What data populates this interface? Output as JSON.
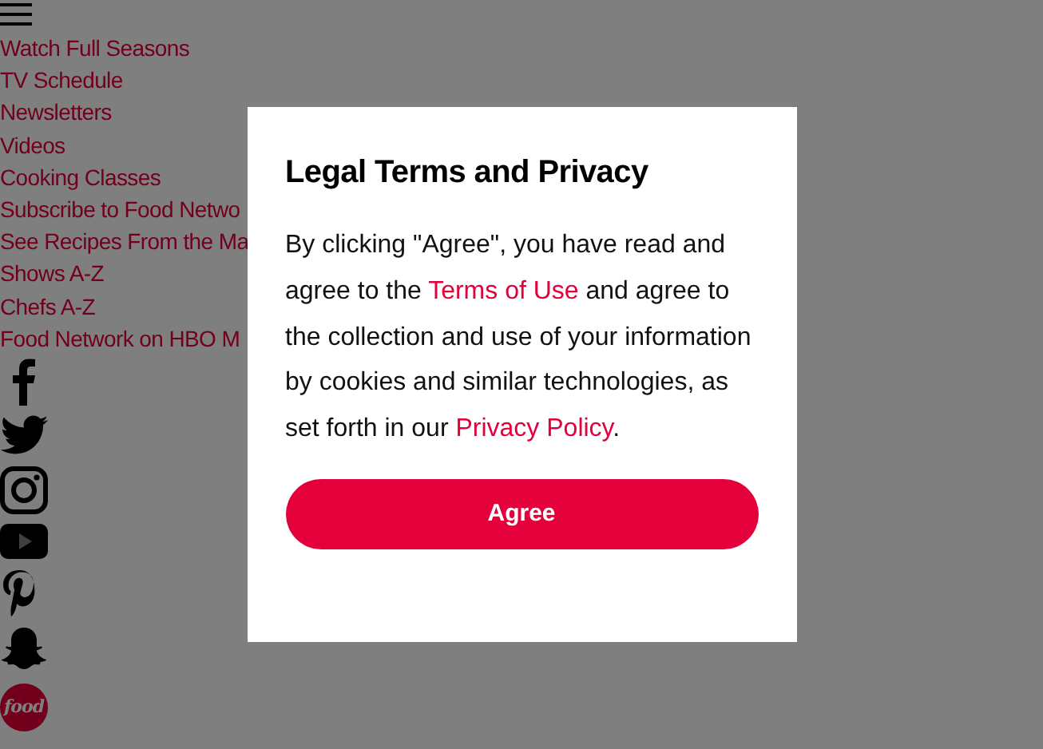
{
  "nav": {
    "items": [
      {
        "label": "Watch Full Seasons"
      },
      {
        "label": "TV Schedule"
      },
      {
        "label": "Newsletters"
      },
      {
        "label": "Videos"
      },
      {
        "label": "Cooking Classes"
      },
      {
        "label": "Subscribe to Food Netwo"
      },
      {
        "label": "See Recipes From the Ma"
      },
      {
        "label": "Shows A-Z"
      },
      {
        "label": "Chefs A-Z"
      },
      {
        "label": "Food Network on HBO M"
      }
    ]
  },
  "logo": {
    "text": "food"
  },
  "dialog": {
    "title": "Legal Terms and Privacy",
    "body": [
      {
        "kind": "text",
        "text": "By clicking \"Agree\", you have read and agree to the "
      },
      {
        "kind": "link",
        "text": "Terms of Use"
      },
      {
        "kind": "text",
        "text": " and agree to the collection and use of your information by cookies and similar technologies, as set forth in our "
      },
      {
        "kind": "link",
        "text": "Privacy Policy"
      },
      {
        "kind": "text",
        "text": "."
      }
    ],
    "button": "Agree"
  }
}
